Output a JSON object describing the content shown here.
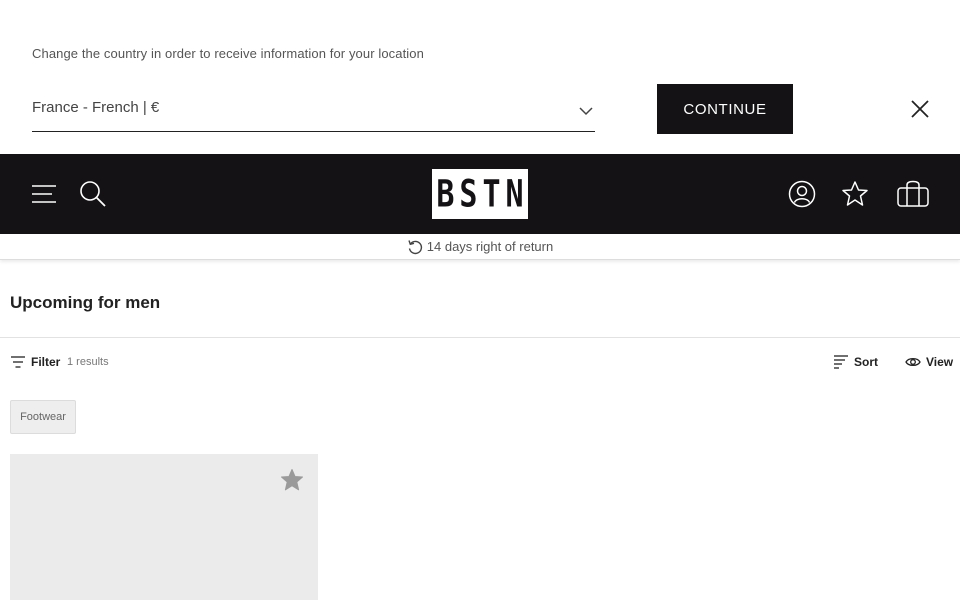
{
  "country_bar": {
    "message": "Change the country in order to receive information for your location",
    "selected_country": "France - French | €",
    "continue_label": "CONTINUE"
  },
  "header": {
    "logo_text": "BSTN",
    "icons": [
      "menu-icon",
      "search-icon",
      "account-icon",
      "wishlist-star-icon",
      "bag-icon"
    ],
    "background_color": "#141215"
  },
  "return_strip": {
    "text": "14 days right of return"
  },
  "page": {
    "title": "Upcoming for men"
  },
  "toolbar": {
    "filter_label": "Filter",
    "results_count": "1 results",
    "sort_label": "Sort",
    "view_label": "View"
  },
  "filters": {
    "chips": [
      "Footwear"
    ]
  },
  "products": [
    {
      "wishlist_icon": "star-icon"
    }
  ]
}
